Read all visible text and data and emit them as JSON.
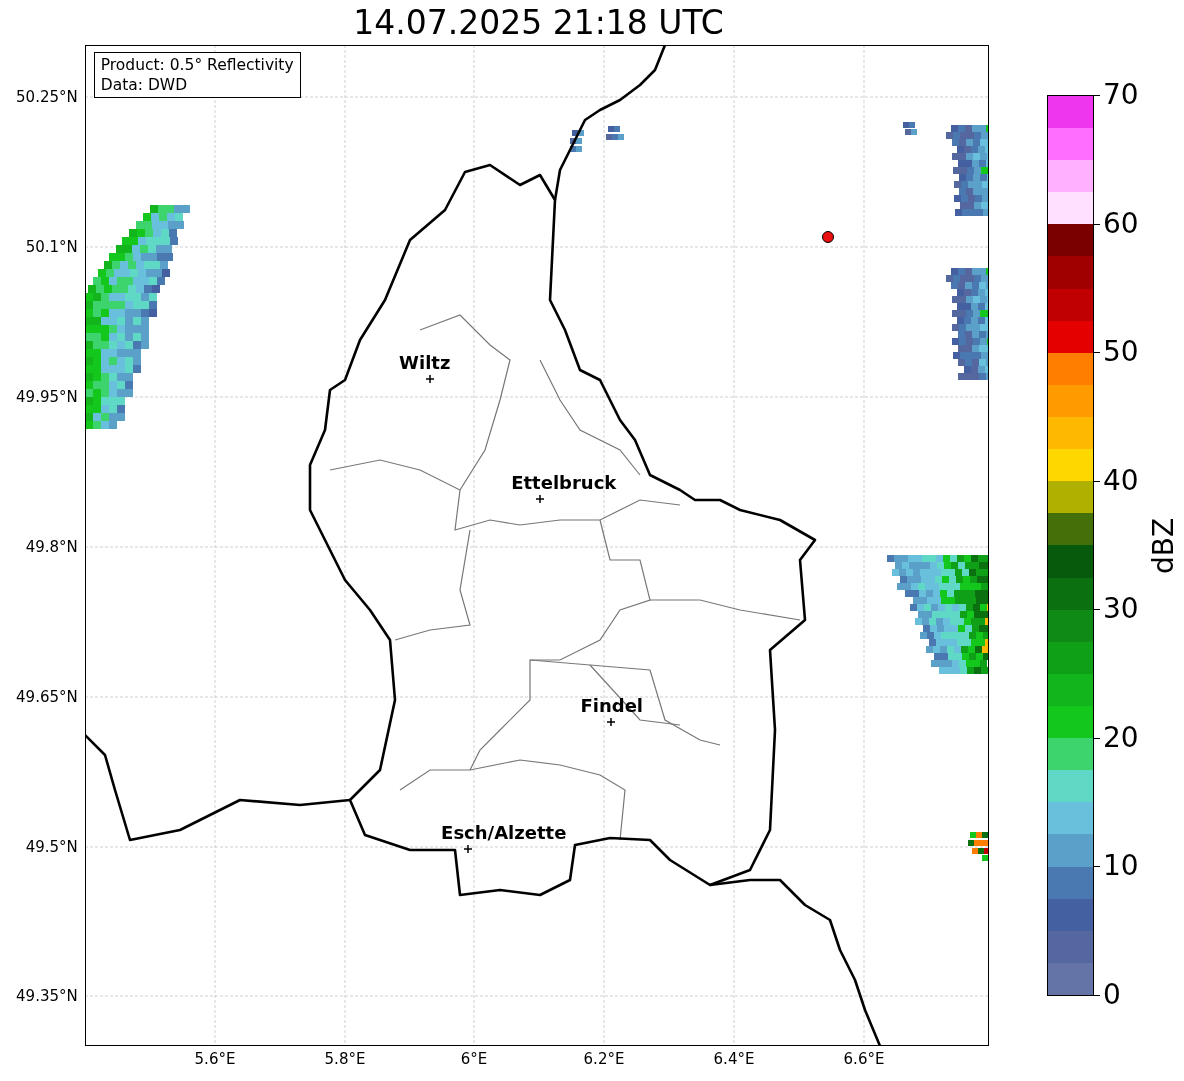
{
  "title": "14.07.2025 21:18 UTC",
  "info_box": [
    "Product: 0.5° Reflectivity",
    "Data: DWD"
  ],
  "map": {
    "y_ticks": [
      "50.25°N",
      "50.1°N",
      "49.95°N",
      "49.8°N",
      "49.65°N",
      "49.5°N",
      "49.35°N"
    ],
    "x_ticks": [
      "5.6°E",
      "5.8°E",
      "6°E",
      "6.2°E",
      "6.4°E",
      "6.6°E"
    ],
    "places": [
      {
        "name": "Wiltz"
      },
      {
        "name": "Ettelbruck"
      },
      {
        "name": "Findel"
      },
      {
        "name": "Esch/Alzette"
      }
    ]
  },
  "colorbar": {
    "label": "dBZ",
    "ticks": [
      "70",
      "60",
      "50",
      "40",
      "30",
      "20",
      "10",
      "0"
    ],
    "segments": [
      {
        "color": "#6474a6"
      },
      {
        "color": "#55679f"
      },
      {
        "color": "#4560a0"
      },
      {
        "color": "#4a78b0"
      },
      {
        "color": "#5aa0c8"
      },
      {
        "color": "#68c0dc"
      },
      {
        "color": "#5fd8c5"
      },
      {
        "color": "#3dd46e"
      },
      {
        "color": "#14c71c"
      },
      {
        "color": "#12b51b"
      },
      {
        "color": "#10a018"
      },
      {
        "color": "#0f8a17"
      },
      {
        "color": "#0b7010"
      },
      {
        "color": "#075a0c"
      },
      {
        "color": "#44700a"
      },
      {
        "color": "#b0b000"
      },
      {
        "color": "#ffd700"
      },
      {
        "color": "#ffb800"
      },
      {
        "color": "#ff9a00"
      },
      {
        "color": "#ff7e00"
      },
      {
        "color": "#e50000"
      },
      {
        "color": "#c00000"
      },
      {
        "color": "#a00000"
      },
      {
        "color": "#7a0000"
      },
      {
        "color": "#ffe0ff"
      },
      {
        "color": "#ffb0ff"
      },
      {
        "color": "#ff6eff"
      },
      {
        "color": "#ee36ee"
      }
    ]
  }
}
